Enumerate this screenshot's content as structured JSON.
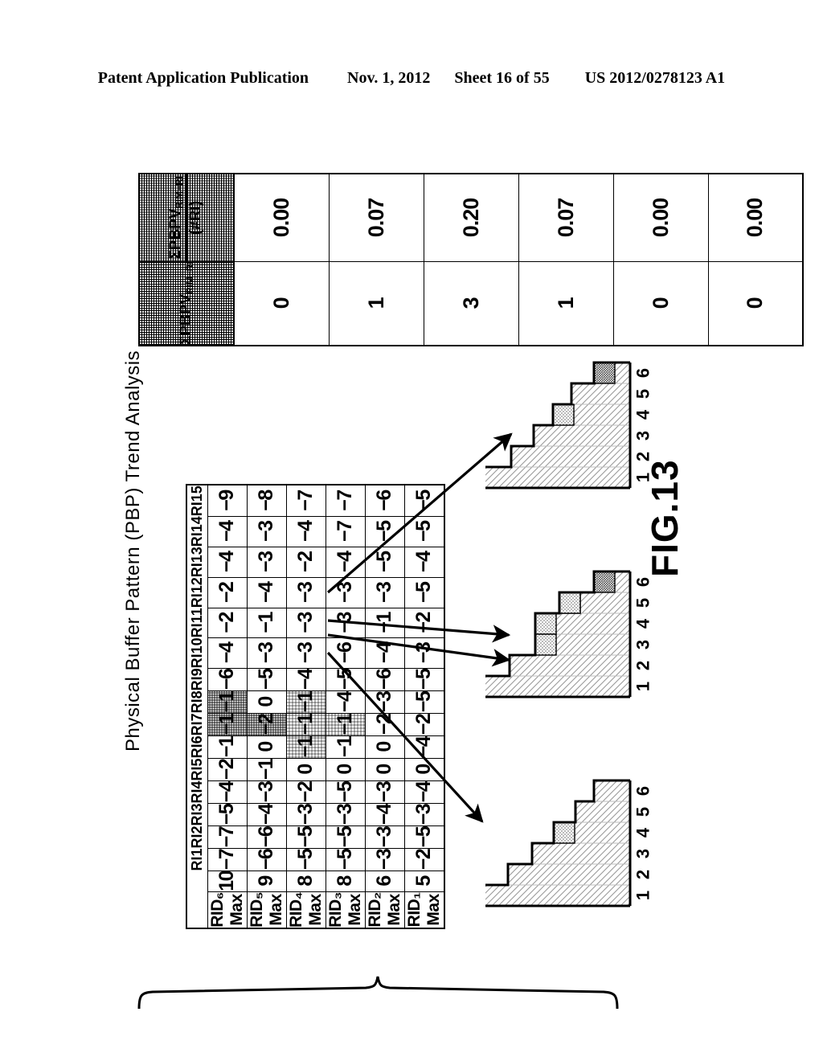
{
  "header": {
    "publication": "Patent Application Publication",
    "date": "Nov. 1, 2012",
    "sheet": "Sheet 16 of 55",
    "patent_number": "US 2012/0278123 A1"
  },
  "figure": {
    "label": "FIG.13",
    "title": "Physical Buffer Pattern (PBP) Trend Analysis"
  },
  "summary_table": {
    "headers": {
      "col1": "ΣPBPV",
      "col1_sub": "RIM−RI",
      "col2_num": "ΣPBPV",
      "col2_num_sub": "RIM−RI",
      "col2_den": "(#RI)"
    },
    "sum_values": [
      "0",
      "1",
      "3",
      "1",
      "0",
      "0"
    ],
    "avg_values": [
      "0.00",
      "0.07",
      "0.20",
      "0.07",
      "0.00",
      "0.00"
    ]
  },
  "chart_data": {
    "type": "table",
    "title": "Physical Buffer Pattern (PBP) Trend Analysis",
    "col_headers": [
      "RI1",
      "RI2",
      "RI3",
      "RI4",
      "RI5",
      "RI6",
      "RI7",
      "RI8",
      "RI9",
      "RI10",
      "RI11",
      "RI12",
      "RI13",
      "RI14",
      "RI15"
    ],
    "row_label_header": "",
    "max_header": "",
    "rows": [
      {
        "label": "RID₆ Max",
        "max": "10",
        "values": [
          "−7",
          "−7",
          "−5",
          "−4",
          "−2",
          "−1",
          "−1",
          "−1",
          "−6",
          "−4",
          "−2",
          "−2",
          "−4",
          "−4",
          "−9"
        ],
        "shading": [
          "",
          "",
          "",
          "",
          "",
          "",
          "dark",
          "dark",
          "",
          "",
          "",
          "",
          "",
          "",
          ""
        ]
      },
      {
        "label": "RID₅ Max",
        "max": "9",
        "values": [
          "−6",
          "−6",
          "−4",
          "−3",
          "−1",
          "0",
          "−2",
          "0",
          "−5",
          "−3",
          "−1",
          "−4",
          "−3",
          "−3",
          "−8"
        ],
        "shading": [
          "",
          "",
          "",
          "",
          "",
          "",
          "dark",
          "",
          "",
          "",
          "",
          "",
          "",
          "",
          ""
        ]
      },
      {
        "label": "RID₄ Max",
        "max": "8",
        "values": [
          "−5",
          "−5",
          "−3",
          "−2",
          "0",
          "−1",
          "−1",
          "−1",
          "−4",
          "−3",
          "−3",
          "−3",
          "−2",
          "−4",
          "−7"
        ],
        "shading": [
          "",
          "",
          "",
          "",
          "",
          "light",
          "light",
          "light",
          "",
          "",
          "",
          "",
          "",
          "",
          ""
        ]
      },
      {
        "label": "RID₃ Max",
        "max": "8",
        "values": [
          "−5",
          "−5",
          "−3",
          "−5",
          "0",
          "−1",
          "−1",
          "−4",
          "−5",
          "−6",
          "−3",
          "−3",
          "−4",
          "−7",
          "−7"
        ],
        "shading": [
          "",
          "",
          "",
          "",
          "",
          "",
          "light",
          "",
          "",
          "",
          "",
          "",
          "",
          "",
          ""
        ]
      },
      {
        "label": "RID₂ Max",
        "max": "6",
        "values": [
          "−3",
          "−3",
          "−4",
          "−3",
          "0",
          "0",
          "−2",
          "−3",
          "−6",
          "−4",
          "−1",
          "−3",
          "−5",
          "−5",
          "−6"
        ],
        "shading": [
          "",
          "",
          "",
          "",
          "",
          "",
          "",
          "",
          "",
          "",
          "",
          "",
          "",
          "",
          ""
        ]
      },
      {
        "label": "RID₁ Max",
        "max": "5",
        "values": [
          "−2",
          "−5",
          "−3",
          "−4",
          "0",
          "−4",
          "−2",
          "−5",
          "−5",
          "−3",
          "−2",
          "−5",
          "−4",
          "−5",
          "−5"
        ],
        "shading": [
          "",
          "",
          "",
          "",
          "",
          "",
          "",
          "",
          "",
          "",
          "",
          "",
          "",
          "",
          ""
        ]
      }
    ]
  },
  "staircase_charts": [
    {
      "name": "chart-top",
      "axis_labels": [
        "1",
        "2",
        "3",
        "4",
        "5",
        "6"
      ],
      "bar_lengths": [
        185,
        148,
        120,
        96,
        73,
        45
      ],
      "segments": [
        {
          "bar": 6,
          "fill": "dark"
        },
        {
          "bar": 4,
          "fill": "light"
        }
      ]
    },
    {
      "name": "chart-middle",
      "axis_labels": [
        "1",
        "2",
        "3",
        "4",
        "5",
        "6"
      ],
      "bar_lengths": [
        185,
        150,
        118,
        118,
        88,
        45
      ],
      "segments": [
        {
          "bar": 6,
          "fill": "dark"
        },
        {
          "bar": 5,
          "fill": "dark"
        },
        {
          "bar": 5,
          "fill": "light"
        },
        {
          "bar": 4,
          "fill": "light"
        },
        {
          "bar": 3,
          "fill": "light"
        }
      ]
    },
    {
      "name": "chart-bottom",
      "axis_labels": [
        "1",
        "2",
        "3",
        "4",
        "5",
        "6"
      ],
      "bar_lengths": [
        190,
        152,
        122,
        95,
        68,
        45
      ],
      "segments": [
        {
          "bar": 4,
          "fill": "light"
        }
      ]
    }
  ],
  "colors": {
    "ink": "#000000",
    "paper": "#ffffff",
    "shade_dark": "#9a9a9a",
    "shade_light": "#d0d0d0"
  }
}
